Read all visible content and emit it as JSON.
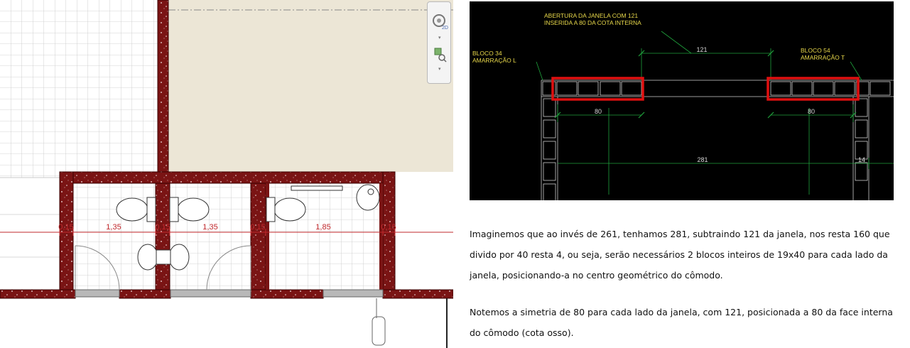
{
  "plan": {
    "dimensions": [
      "0,15",
      "1,35",
      "0,15",
      "1,35",
      "0,15",
      "1,85",
      "0,15"
    ]
  },
  "viewcube": {
    "icon_top": "2D-steering-wheel-icon",
    "icon_bottom": "zoom-region-icon"
  },
  "cad": {
    "note_window_line1": "ABERTURA DA JANELA COM 121",
    "note_window_line2": "INSERIDA A 80 DA COTA INTERNA",
    "note_left_line1": "BLOCO 34",
    "note_left_line2": "AMARRAÇÃO L",
    "note_right_line1": "BLOCO 54",
    "note_right_line2": "AMARRAÇÃO T",
    "dim_window": "121",
    "dim_left": "80",
    "dim_right": "80",
    "dim_total": "281",
    "dim_wall": "14",
    "highlight_color": "#e01010"
  },
  "text": {
    "paragraph1": "Imaginemos que ao invés de 261, tenhamos 281, subtraindo 121 da janela, nos resta 160 que divido por 40 resta 4, ou seja, serão necessários 2 blocos inteiros de 19x40 para cada lado da janela, posicionando-a no centro geométrico do cômodo.",
    "paragraph2": "Notemos a simetria de 80 para cada lado da janela, com 121, posicionada a 80 da face interna do cômodo (cota osso)."
  }
}
